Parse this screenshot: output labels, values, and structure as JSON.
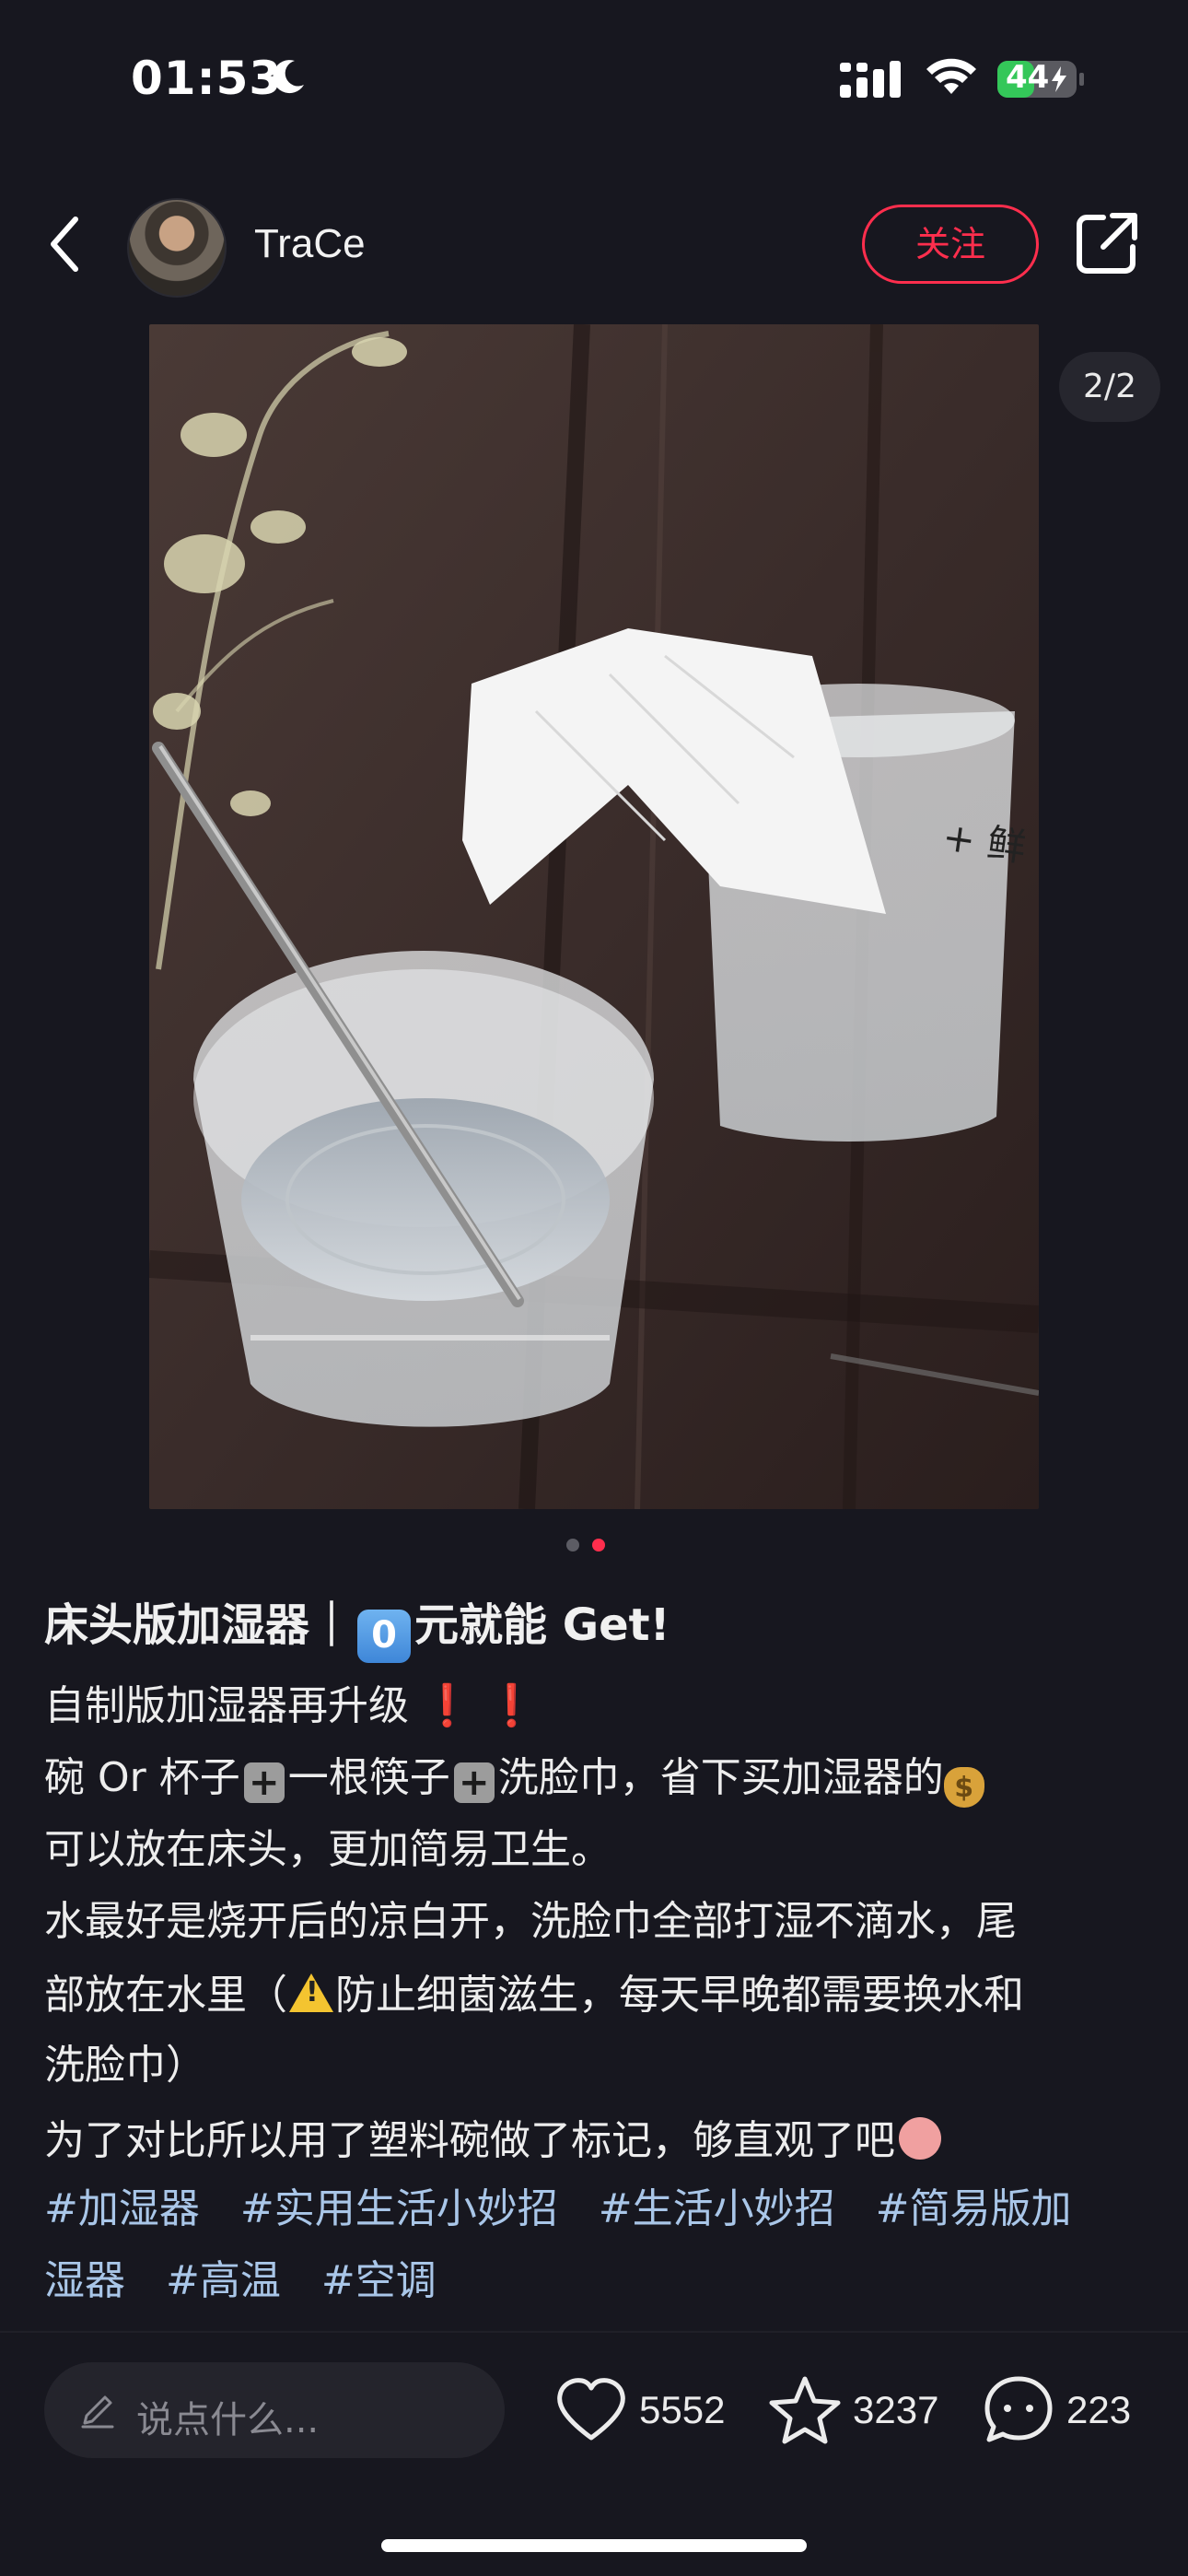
{
  "status_bar": {
    "time": "01:53",
    "battery": "44",
    "icons": [
      "moon-icon",
      "cellular-signal-icon",
      "wifi-icon",
      "battery-icon"
    ]
  },
  "header": {
    "username": "TraCe",
    "follow_label": "关注",
    "back_icon": "chevron-left-icon",
    "share_icon": "share-icon"
  },
  "media": {
    "page_indicator": "2/2",
    "total": 2,
    "current": 2
  },
  "post": {
    "title_prefix": "床头版加湿器｜",
    "title_key": "0",
    "title_suffix": "元就能 Get!",
    "lines": {
      "l1": "自制版加湿器再升级",
      "l1_marks": "❗ ❗",
      "l2_a": "碗 Or 杯子",
      "l2_b": "一根筷子",
      "l2_c": "洗脸巾，省下买加湿器的",
      "l3": "可以放在床头，更加简易卫生。",
      "l4": "水最好是烧开后的凉白开，洗脸巾全部打湿不滴水，尾",
      "l5_a": "部放在水里（",
      "l5_b": "防止细菌滋生，每天早晚都需要换水和",
      "l6": "洗脸巾）",
      "l7": "为了对比所以用了塑料碗做了标记，够直观了吧"
    },
    "tags_line1": [
      "#加湿器",
      "#实用生活小妙招",
      "#生活小妙招",
      "#简易版加"
    ],
    "tags_line2": [
      "湿器",
      "#高温",
      "#空调"
    ]
  },
  "bottom_bar": {
    "comment_placeholder": "说点什么...",
    "likes": "5552",
    "favorites": "3237",
    "comments": "223"
  },
  "colors": {
    "background": "#17171f",
    "accent": "#ff2e4d",
    "tag": "#a9c6e8",
    "battery_green": "#34c759"
  }
}
